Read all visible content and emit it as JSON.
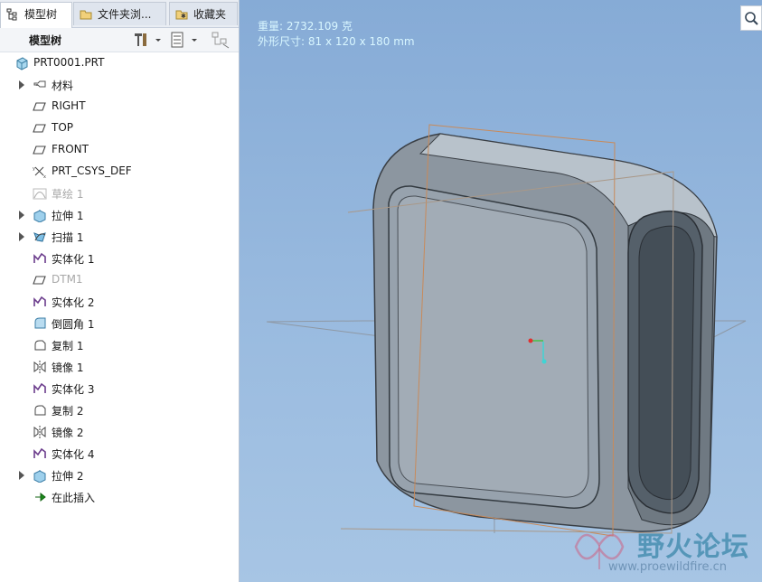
{
  "tabs": [
    {
      "label": "模型树",
      "icon": "tree-icon",
      "active": true
    },
    {
      "label": "文件夹浏...",
      "icon": "folder-icon",
      "active": false
    },
    {
      "label": "收藏夹",
      "icon": "favorites-icon",
      "active": false
    }
  ],
  "toolbar": {
    "title": "模型树"
  },
  "tree": [
    {
      "label": "PRT0001.PRT",
      "icon": "part-icon",
      "expandable": false,
      "dim": false,
      "root": true
    },
    {
      "label": "材料",
      "icon": "material-icon",
      "expandable": true,
      "dim": false
    },
    {
      "label": "RIGHT",
      "icon": "datum-plane-icon",
      "expandable": false,
      "dim": false
    },
    {
      "label": "TOP",
      "icon": "datum-plane-icon",
      "expandable": false,
      "dim": false
    },
    {
      "label": "FRONT",
      "icon": "datum-plane-icon",
      "expandable": false,
      "dim": false
    },
    {
      "label": "PRT_CSYS_DEF",
      "icon": "csys-icon",
      "expandable": false,
      "dim": false
    },
    {
      "label": "草绘 1",
      "icon": "sketch-icon",
      "expandable": false,
      "dim": true
    },
    {
      "label": "拉伸 1",
      "icon": "extrude-icon",
      "expandable": true,
      "dim": false
    },
    {
      "label": "扫描 1",
      "icon": "sweep-icon",
      "expandable": true,
      "dim": false
    },
    {
      "label": "实体化 1",
      "icon": "solidify-icon",
      "expandable": false,
      "dim": false
    },
    {
      "label": "DTM1",
      "icon": "datum-plane-icon",
      "expandable": false,
      "dim": true
    },
    {
      "label": "实体化 2",
      "icon": "solidify-icon",
      "expandable": false,
      "dim": false
    },
    {
      "label": "倒圆角 1",
      "icon": "round-icon",
      "expandable": false,
      "dim": false
    },
    {
      "label": "复制 1",
      "icon": "copy-icon",
      "expandable": false,
      "dim": false
    },
    {
      "label": "镜像 1",
      "icon": "mirror-icon",
      "expandable": false,
      "dim": false
    },
    {
      "label": "实体化 3",
      "icon": "solidify-icon",
      "expandable": false,
      "dim": false
    },
    {
      "label": "复制 2",
      "icon": "copy-icon",
      "expandable": false,
      "dim": false
    },
    {
      "label": "镜像 2",
      "icon": "mirror-icon",
      "expandable": false,
      "dim": false
    },
    {
      "label": "实体化 4",
      "icon": "solidify-icon",
      "expandable": false,
      "dim": false
    },
    {
      "label": "拉伸 2",
      "icon": "extrude-icon",
      "expandable": true,
      "dim": false
    },
    {
      "label": "在此插入",
      "icon": "insert-here-icon",
      "expandable": false,
      "dim": false
    }
  ],
  "viewport": {
    "info_line1": "重量: 2732.109 克",
    "info_line2": "外形尺寸: 81 x 120 x 180 mm"
  },
  "watermark": {
    "text": "野火论坛",
    "url": "www.proewildfire.cn"
  },
  "colors": {
    "viewport_top": "#86abd6",
    "viewport_bottom": "#a7c5e4",
    "model_face": "#8f9aa4",
    "datum_orange": "#c88a5a"
  }
}
